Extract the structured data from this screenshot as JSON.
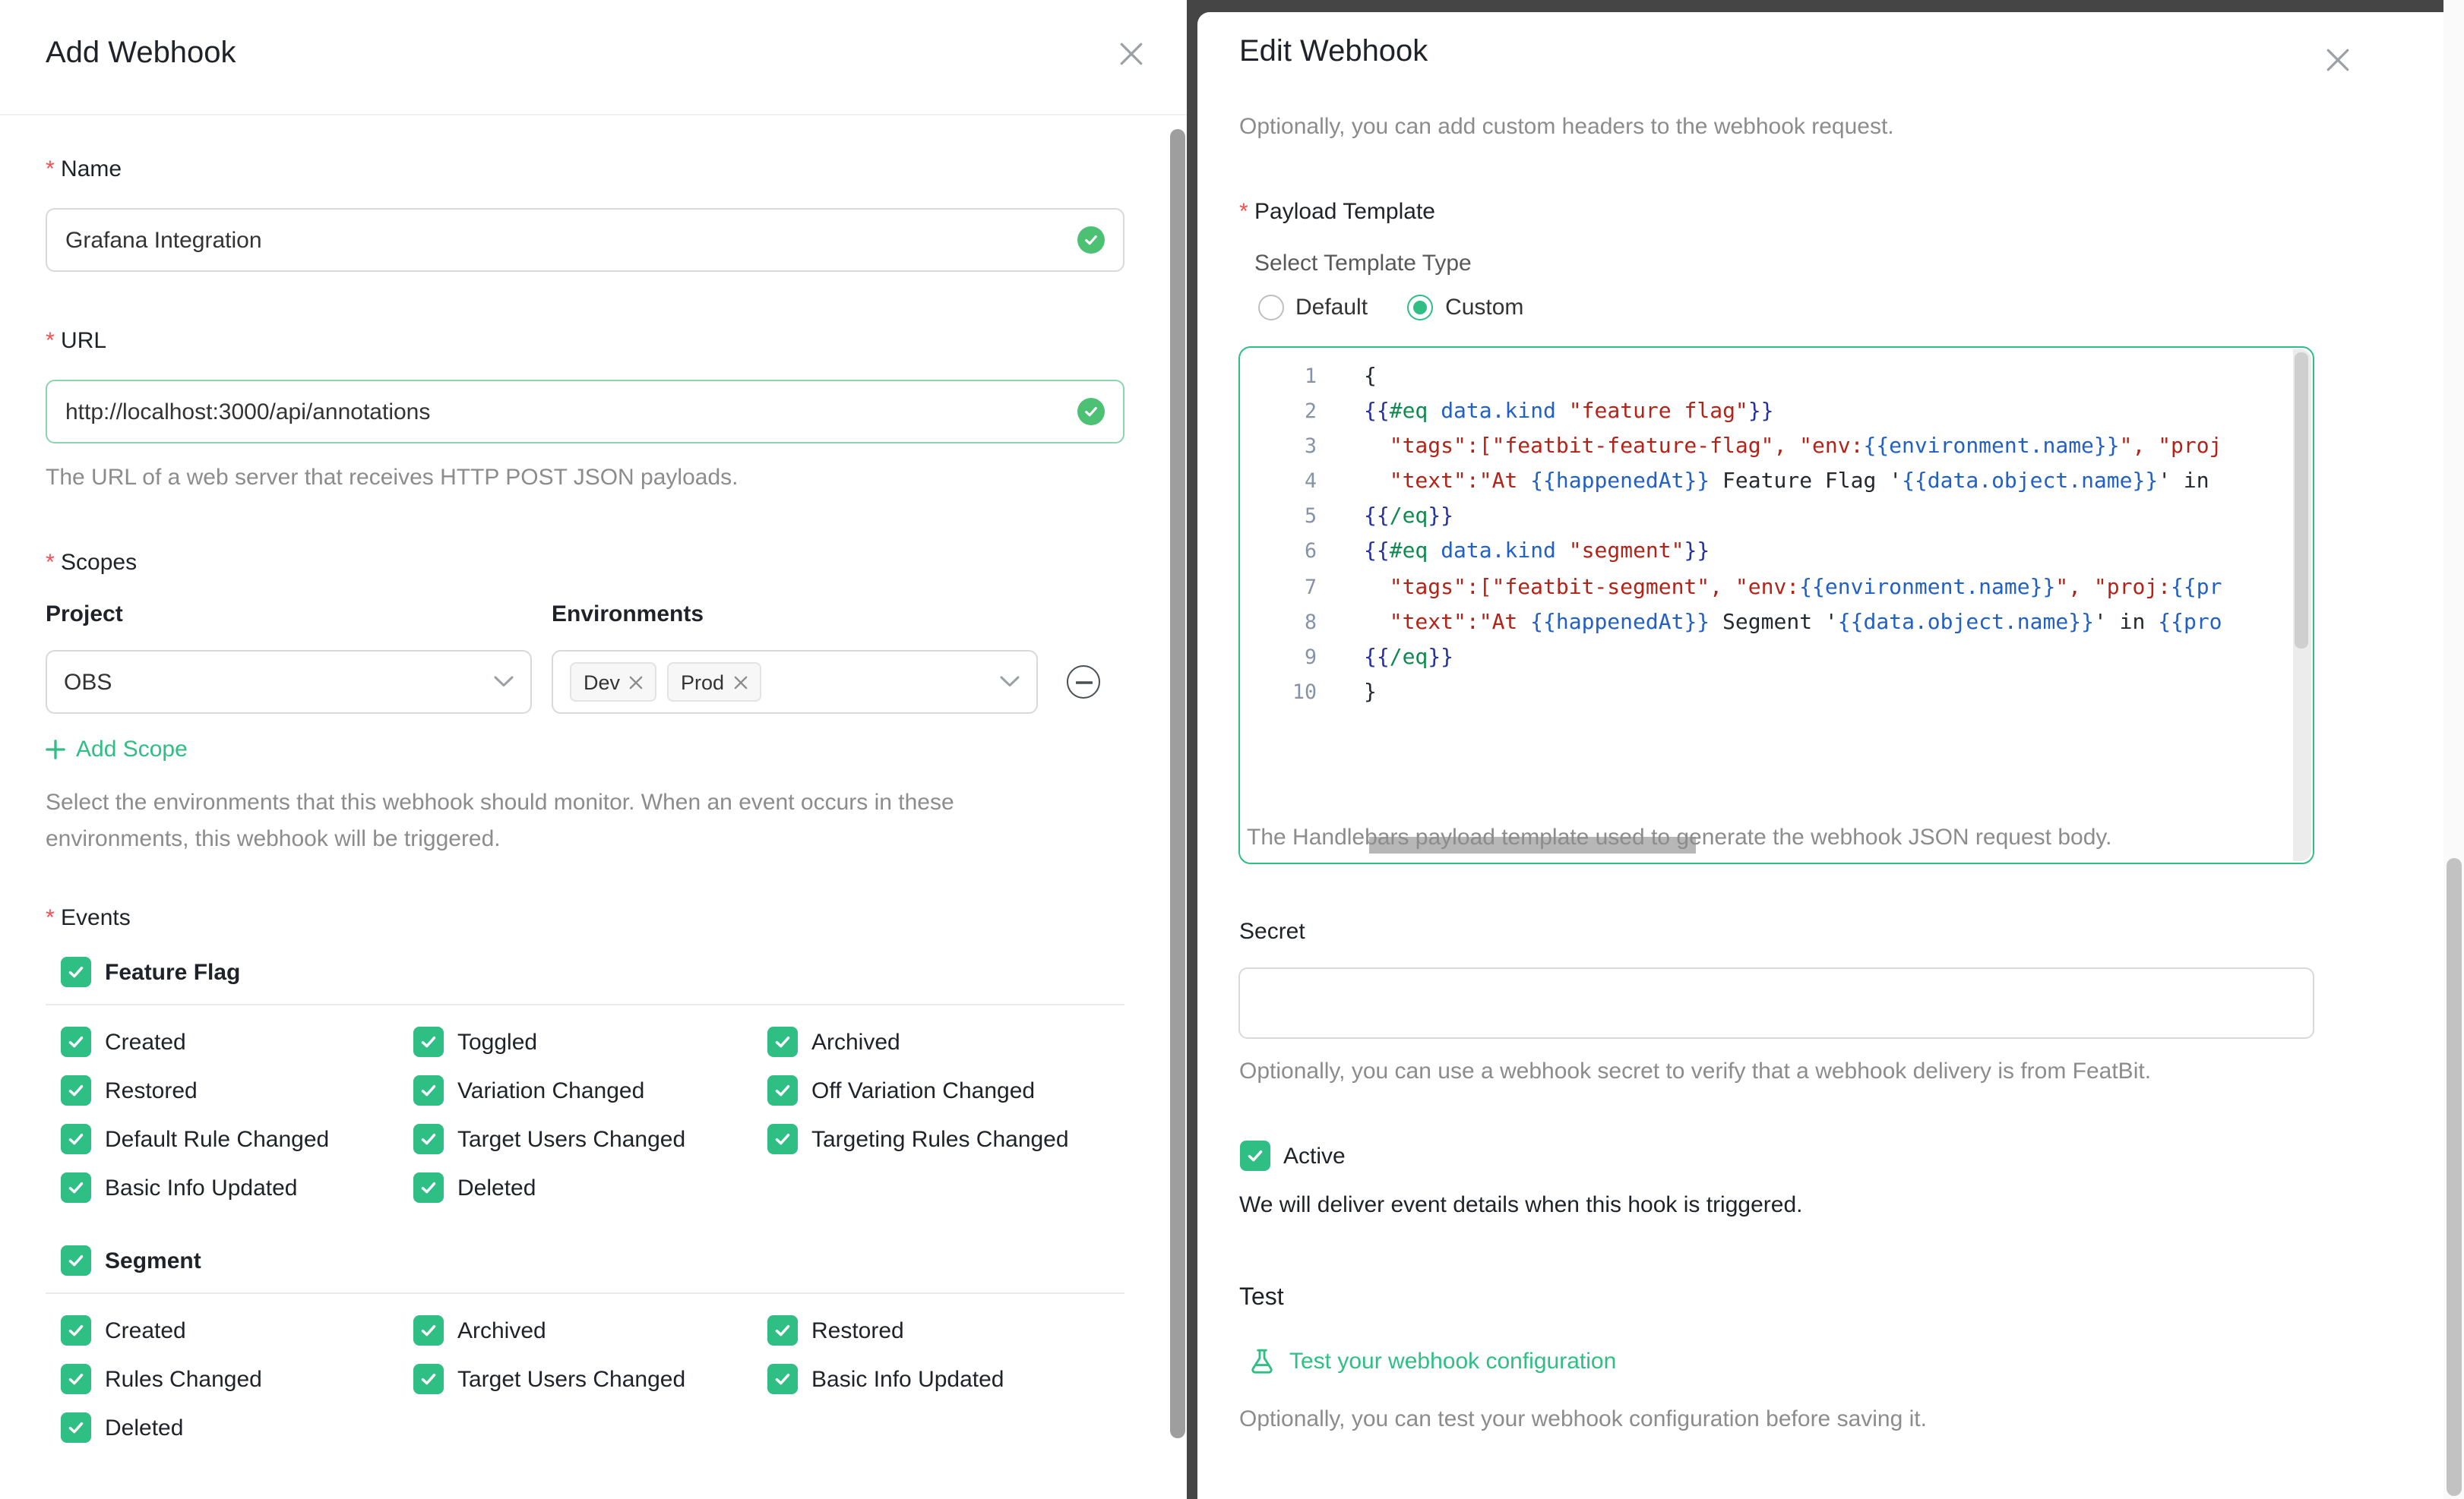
{
  "colors": {
    "accent": "#2fbe84",
    "danger": "#ff4d4f"
  },
  "add_webhook": {
    "title": "Add Webhook",
    "fields": {
      "name": {
        "label": "Name",
        "value": "Grafana Integration"
      },
      "url": {
        "label": "URL",
        "value": "http://localhost:3000/api/annotations",
        "help": "The URL of a web server that receives HTTP POST JSON payloads."
      }
    },
    "scopes": {
      "label": "Scopes",
      "project_label": "Project",
      "environments_label": "Environments",
      "project_value": "OBS",
      "environment_tags": [
        "Dev",
        "Prod"
      ],
      "add_scope": "Add Scope",
      "help": "Select the environments that this webhook should monitor. When an event occurs in these environments, this webhook will be triggered."
    },
    "events": {
      "label": "Events",
      "groups": [
        {
          "name": "Feature Flag",
          "checked": true,
          "rows": [
            [
              "Created",
              "Toggled",
              "Archived"
            ],
            [
              "Restored",
              "Variation Changed",
              "Off Variation Changed"
            ],
            [
              "Default Rule Changed",
              "Target Users Changed",
              "Targeting Rules Changed"
            ],
            [
              "Basic Info Updated",
              "Deleted"
            ]
          ]
        },
        {
          "name": "Segment",
          "checked": true,
          "rows": [
            [
              "Created",
              "Archived",
              "Restored"
            ],
            [
              "Rules Changed",
              "Target Users Changed",
              "Basic Info Updated"
            ],
            [
              "Deleted"
            ]
          ]
        }
      ]
    }
  },
  "edit_webhook": {
    "title": "Edit Webhook",
    "headers_help": "Optionally, you can add custom headers to the webhook request.",
    "payload_template": {
      "label": "Payload Template",
      "type_label": "Select Template Type",
      "type_options": [
        "Default",
        "Custom"
      ],
      "selected_option": "Custom",
      "help": "The Handlebars payload template used to generate the webhook JSON request body.",
      "code_lines": [
        [
          [
            "p",
            "{"
          ]
        ],
        [
          [
            "b",
            "{{"
          ],
          [
            "k",
            "#eq"
          ],
          [
            "p",
            " "
          ],
          [
            "v",
            "data.kind"
          ],
          [
            "p",
            " "
          ],
          [
            "s",
            "\"feature flag\""
          ],
          [
            "b",
            "}}"
          ]
        ],
        [
          [
            "s",
            "  \"tags\":[\"featbit-feature-flag\", \"env:"
          ],
          [
            "v",
            "{{environment.name}}"
          ],
          [
            "s",
            "\", \"proj"
          ]
        ],
        [
          [
            "s",
            "  \"text\":\"At "
          ],
          [
            "v",
            "{{happenedAt}}"
          ],
          [
            "p",
            " Feature Flag '"
          ],
          [
            "v",
            "{{data.object.name}}"
          ],
          [
            "p",
            "' in"
          ]
        ],
        [
          [
            "b",
            "{{"
          ],
          [
            "k",
            "/eq"
          ],
          [
            "b",
            "}}"
          ]
        ],
        [
          [
            "b",
            "{{"
          ],
          [
            "k",
            "#eq"
          ],
          [
            "p",
            " "
          ],
          [
            "v",
            "data.kind"
          ],
          [
            "p",
            " "
          ],
          [
            "s",
            "\"segment\""
          ],
          [
            "b",
            "}}"
          ]
        ],
        [
          [
            "s",
            "  \"tags\":[\"featbit-segment\", \"env:"
          ],
          [
            "v",
            "{{environment.name}}"
          ],
          [
            "s",
            "\", \"proj:"
          ],
          [
            "v",
            "{{pr"
          ]
        ],
        [
          [
            "s",
            "  \"text\":\"At "
          ],
          [
            "v",
            "{{happenedAt}}"
          ],
          [
            "p",
            " Segment '"
          ],
          [
            "v",
            "{{data.object.name}}"
          ],
          [
            "p",
            "' in "
          ],
          [
            "v",
            "{{pro"
          ]
        ],
        [
          [
            "b",
            "{{"
          ],
          [
            "k",
            "/eq"
          ],
          [
            "b",
            "}}"
          ]
        ],
        [
          [
            "p",
            "}"
          ]
        ]
      ]
    },
    "secret": {
      "label": "Secret",
      "value": "",
      "help": "Optionally, you can use a webhook secret to verify that a webhook delivery is from FeatBit."
    },
    "active": {
      "label": "Active",
      "checked": true,
      "note": "We will deliver event details when this hook is triggered."
    },
    "test": {
      "label": "Test",
      "link_label": "Test your webhook configuration",
      "help": "Optionally, you can test your webhook configuration before saving it."
    }
  }
}
